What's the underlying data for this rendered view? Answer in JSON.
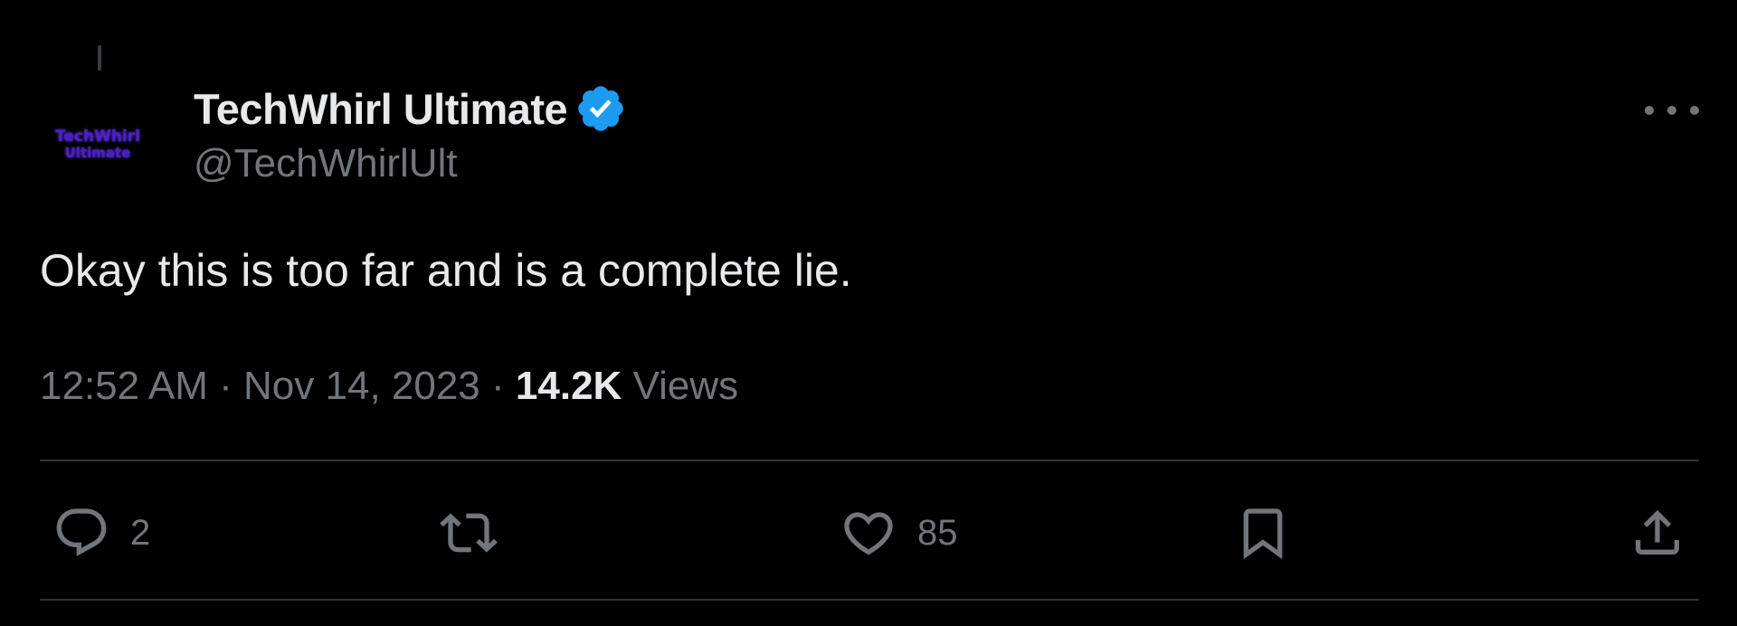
{
  "post": {
    "author": {
      "avatar_text_line1": "TechWhirl",
      "avatar_text_line2": "Ultimate",
      "display_name": "TechWhirl Ultimate",
      "handle": "@TechWhirlUlt",
      "verified": true
    },
    "text": "Okay this is too far and is a complete lie.",
    "meta": {
      "time": "12:52 AM",
      "separator": "·",
      "date": "Nov 14, 2023",
      "views_count": "14.2K",
      "views_label": "Views"
    },
    "actions": {
      "replies": "2",
      "reposts": "",
      "likes": "85"
    }
  },
  "icons": {
    "more": "more-horizontal-icon",
    "verified": "verified-badge-icon",
    "reply": "reply-icon",
    "repost": "repost-icon",
    "like": "heart-icon",
    "bookmark": "bookmark-icon",
    "share": "share-icon"
  },
  "colors": {
    "background": "#000000",
    "primary_text": "#e7e9ea",
    "secondary_text": "#71767b",
    "divider": "#2f3336",
    "verified_blue": "#1d9bf0",
    "avatar_purple": "#4b1fc9"
  }
}
